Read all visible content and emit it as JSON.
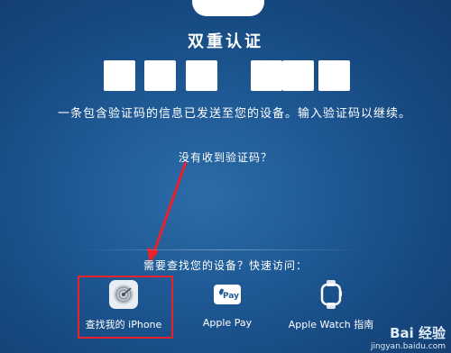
{
  "title": "双重认证",
  "code_boxes": [
    "",
    "",
    "",
    "",
    "",
    ""
  ],
  "info_text": "一条包含验证码的信息已发送至您的设备。输入验证码以继续。",
  "no_code_link": "没有收到验证码？",
  "need_find_text": "需要查找您的设备？快速访问：",
  "apps": [
    {
      "label": "查找我的 iPhone",
      "icon": "find-my-iphone-icon"
    },
    {
      "label": "Apple Pay",
      "icon": "apple-pay-icon"
    },
    {
      "label": "Apple Watch 指南",
      "icon": "apple-watch-icon"
    }
  ],
  "apple_pay_icon_text": "Pay",
  "watermark": {
    "logo": "Bai 经验",
    "url": "jingyan.baidu.com"
  },
  "colors": {
    "annotation": "#e8212b",
    "background": "#1f5a96"
  }
}
